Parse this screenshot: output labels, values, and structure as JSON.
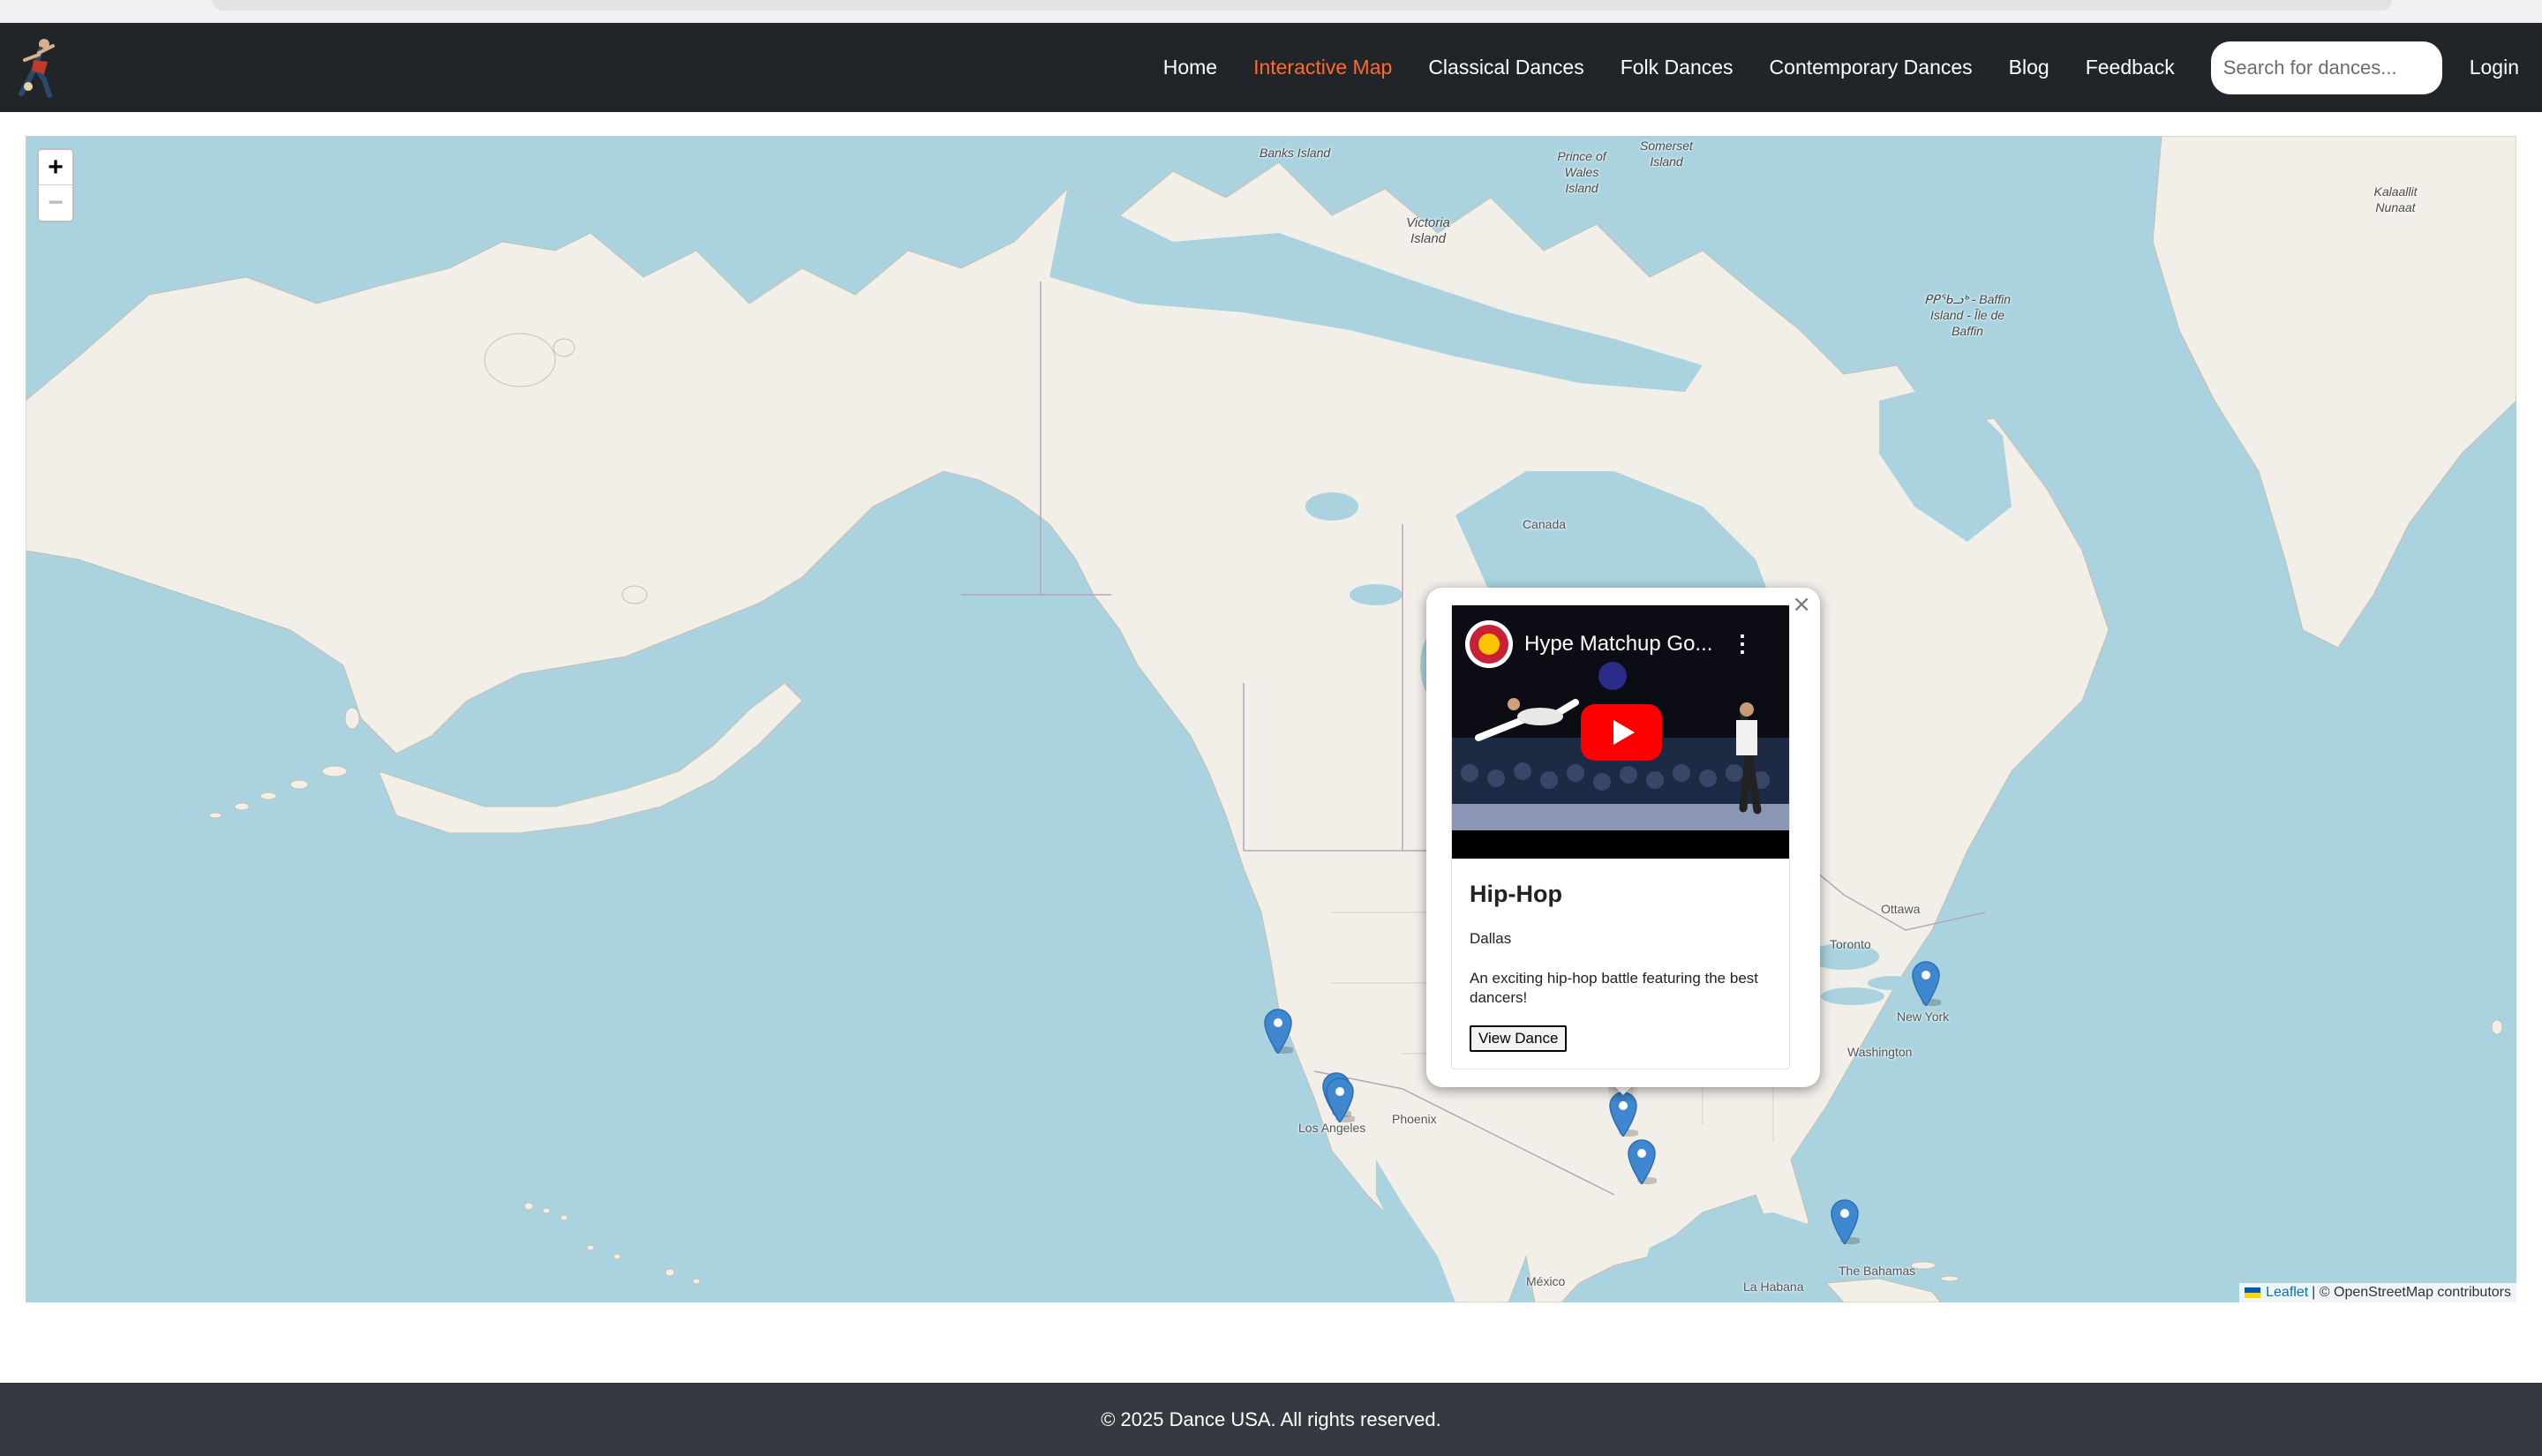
{
  "site": {
    "brand_icon": "dancer-logo-icon"
  },
  "nav": {
    "items": [
      {
        "label": "Home",
        "active": false
      },
      {
        "label": "Interactive Map",
        "active": true
      },
      {
        "label": "Classical Dances",
        "active": false
      },
      {
        "label": "Folk Dances",
        "active": false
      },
      {
        "label": "Contemporary Dances",
        "active": false
      },
      {
        "label": "Blog",
        "active": false
      },
      {
        "label": "Feedback",
        "active": false
      }
    ],
    "search_placeholder": "Search for dances...",
    "login_label": "Login"
  },
  "map": {
    "zoom_in": "+",
    "zoom_out": "−",
    "labels": {
      "banks": "Banks Island",
      "prince_wales": "Prince of Wales Island",
      "somerset": "Somerset Island",
      "victoria": "Victoria Island",
      "kalaallit": "Kalaallit Nunaat",
      "baffin": "ᑭᑭᖃᓗᒃ - Baffin Island - Île de Baffin",
      "canada": "Canada",
      "ottawa": "Ottawa",
      "toronto": "Toronto",
      "new_york": "New York",
      "washington": "Washington",
      "los_angeles": "Los Angeles",
      "phoenix": "Phoenix",
      "mexico": "México",
      "la_habana": "La Habana",
      "bahamas": "The Bahamas"
    },
    "attribution": {
      "leaflet": "Leaflet",
      "rest": "| © OpenStreetMap contributors"
    },
    "marker_icon": "map-pin-icon",
    "marker_count": 7
  },
  "popup": {
    "close": "×",
    "video_title": "Hype Matchup Go...",
    "video_menu": "⋮",
    "title": "Hip-Hop",
    "city": "Dallas",
    "description": "An exciting hip-hop battle featuring the best dancers!",
    "button_label": "View Dance"
  },
  "footer": {
    "copyright": "© 2025 Dance USA. All rights reserved."
  },
  "colors": {
    "navbar": "#212529",
    "active_link": "#ff6a2b",
    "water": "#aad3df",
    "land": "#f2efe9",
    "marker": "#3f87cf",
    "footer": "#343a40"
  }
}
